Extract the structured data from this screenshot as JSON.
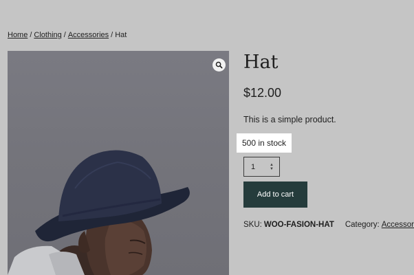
{
  "breadcrumb": {
    "items": [
      "Home",
      "Clothing",
      "Accessories"
    ],
    "separator": "/",
    "current": "Hat"
  },
  "product": {
    "title": "Hat",
    "price": "$12.00",
    "description": "This is a simple product.",
    "stock": "500 in stock",
    "quantity": "1",
    "add_to_cart_label": "Add to cart",
    "sku_label": "SKU:",
    "sku_value": "WOO-FASION-HAT",
    "category_label": "Category:",
    "category_value": "Accessories"
  },
  "icons": {
    "zoom": "search-icon",
    "qty_spinner": "stepper-arrows-icon"
  },
  "colors": {
    "background": "#c5c5c5",
    "button": "#253c3c",
    "stock_highlight": "#ffffff",
    "text": "#1e1e1e"
  }
}
